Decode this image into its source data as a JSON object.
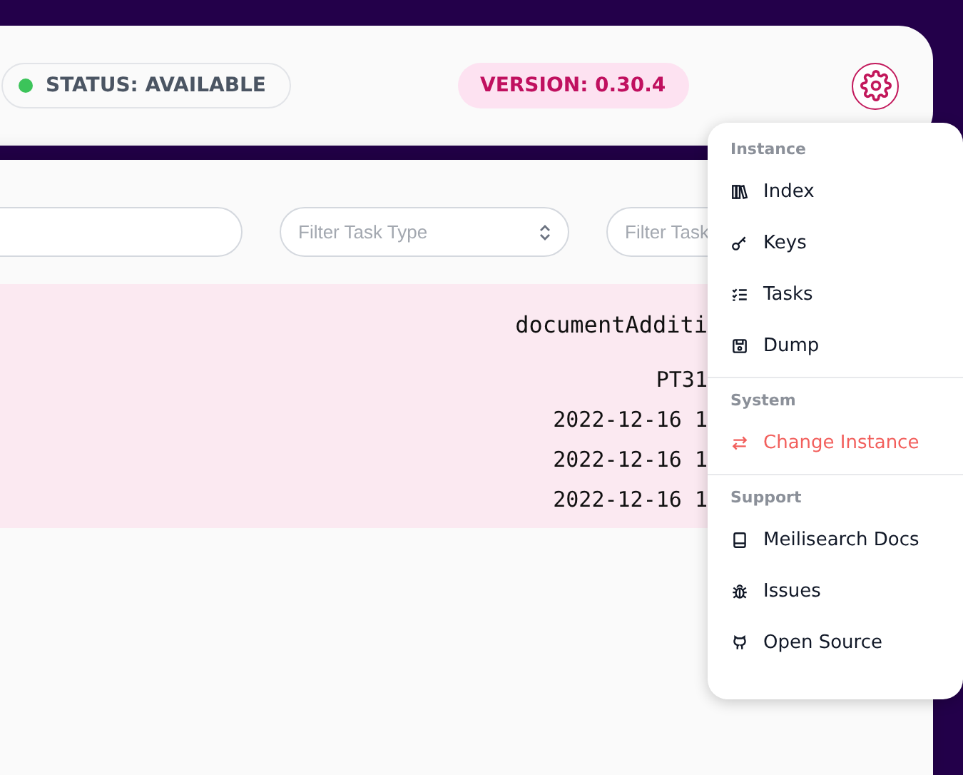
{
  "header": {
    "status": {
      "label": "STATUS: AVAILABLE",
      "available": true
    },
    "version": "VERSION: 0.30.4"
  },
  "filters": [
    {
      "kind": "text"
    },
    {
      "placeholder": "Filter Task Type",
      "kind": "select"
    },
    {
      "placeholder": "Filter Task",
      "kind": "text"
    }
  ],
  "task_card": {
    "lines": [
      "documentAdditi",
      "PT31",
      "2022-12-16 1",
      "2022-12-16 1",
      "2022-12-16 1"
    ]
  },
  "settings_menu": {
    "sections": [
      {
        "title": "Instance",
        "items": [
          {
            "label": "Index",
            "kind": "normal"
          },
          {
            "label": "Keys",
            "kind": "normal"
          },
          {
            "label": "Tasks",
            "kind": "normal"
          },
          {
            "label": "Dump",
            "kind": "normal"
          }
        ]
      },
      {
        "title": "System",
        "items": [
          {
            "label": "Change Instance",
            "kind": "danger"
          }
        ]
      },
      {
        "title": "Support",
        "items": [
          {
            "label": "Meilisearch Docs",
            "kind": "normal"
          },
          {
            "label": "Issues",
            "kind": "normal"
          },
          {
            "label": "Open Source",
            "kind": "normal"
          }
        ]
      }
    ]
  }
}
